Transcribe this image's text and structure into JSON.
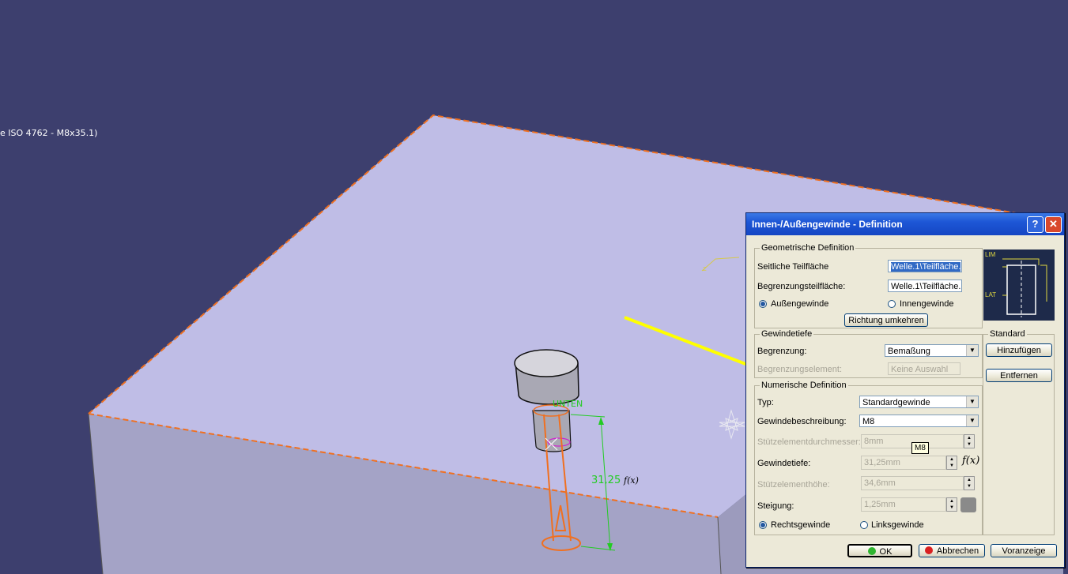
{
  "viewport": {
    "overlay_text": "e ISO 4762 - M8x35.1)",
    "dimension_value": "31,25",
    "dimension_fx": "f(x)",
    "unten_label": "UNTEN"
  },
  "dialog": {
    "title": "Innen-/Außengewinde - Definition",
    "help_label": "?",
    "close_label": "✕",
    "geometric": {
      "legend": "Geometrische Definition",
      "lateral_label": "Seitliche Teilfläche",
      "lateral_value": "Welle.1\\Teilfläche.",
      "limit_label": "Begrenzungsteilfläche:",
      "limit_value": "Welle.1\\Teilfläche.",
      "outer_label": "Außengewinde",
      "inner_label": "Innengewinde",
      "outer_selected": true,
      "reverse_button": "Richtung umkehren"
    },
    "preview": {
      "lim_label": "LIM",
      "lat_label": "LAT"
    },
    "depth": {
      "legend": "Gewindetiefe",
      "limit_type_label": "Begrenzung:",
      "limit_type_value": "Bemaßung",
      "limit_element_label": "Begrenzungselement:",
      "limit_element_value": "Keine Auswahl"
    },
    "numeric": {
      "legend": "Numerische Definition",
      "type_label": "Typ:",
      "type_value": "Standardgewinde",
      "desc_label": "Gewindebeschreibung:",
      "desc_value": "M8",
      "support_diameter_label": "Stützelementdurchmesser:",
      "support_diameter_value": "8mm",
      "tooltip": "M8",
      "thread_depth_label": "Gewindetiefe:",
      "thread_depth_value": "31,25mm",
      "support_height_label": "Stützelementhöhe:",
      "support_height_value": "34,6mm",
      "pitch_label": "Steigung:",
      "pitch_value": "1,25mm",
      "right_label": "Rechtsgewinde",
      "left_label": "Linksgewinde",
      "right_selected": true
    },
    "standard": {
      "legend": "Standard",
      "add_button": "Hinzufügen",
      "remove_button": "Entfernen"
    },
    "footer": {
      "ok": "OK",
      "cancel": "Abbrechen",
      "preview": "Voranzeige"
    }
  },
  "colors": {
    "background": "#3d3f6e",
    "plate_top": "#bfbde6",
    "plate_side": "#a4a3c6",
    "edge": "#f07020",
    "highlight_line": "#ffff00",
    "dimension": "#22cc22"
  }
}
